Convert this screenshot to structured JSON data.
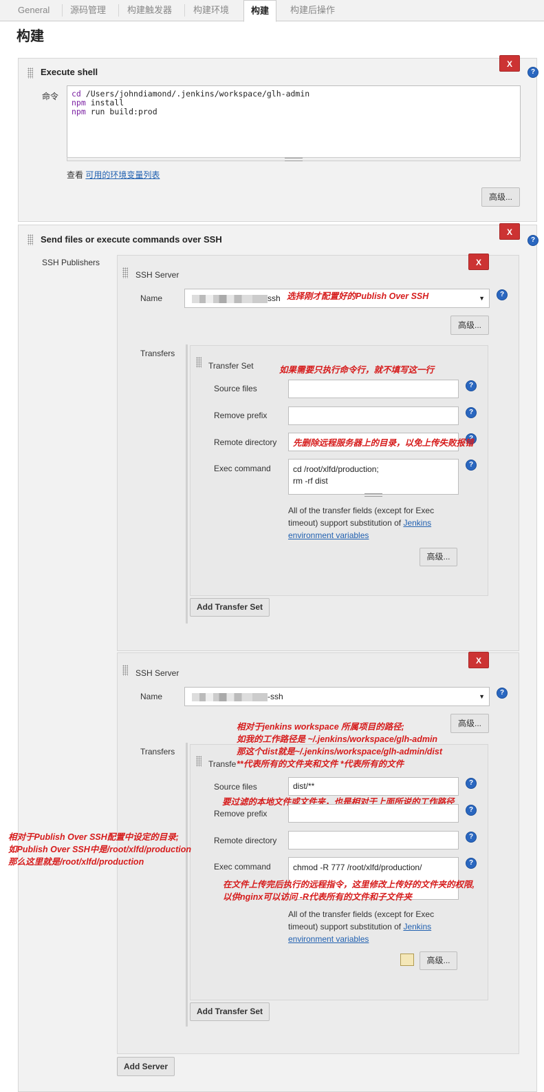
{
  "tabs": [
    "General",
    "源码管理",
    "构建触发器",
    "构建环境",
    "构建",
    "构建后操作"
  ],
  "page_title": "构建",
  "execute_shell": {
    "title": "Execute shell",
    "command_label": "命令",
    "command_lines": [
      {
        "kw": "cd",
        "rest": " /Users/johndiamond/.jenkins/workspace/glh-admin"
      },
      {
        "kw": "npm",
        "rest": " install"
      },
      {
        "kw": "npm",
        "rest": " run build:prod"
      }
    ],
    "env_prefix": "查看",
    "env_link": "可用的环境变量列表",
    "advanced": "高级..."
  },
  "ssh": {
    "title": "Send files or execute commands over SSH",
    "publishers_label": "SSH Publishers",
    "server_label": "SSH Server",
    "name_label": "Name",
    "transfers_label": "Transfers",
    "transfer_set_label": "Transfer Set",
    "source_label": "Source files",
    "remove_prefix_label": "Remove prefix",
    "remote_dir_label": "Remote directory",
    "exec_label": "Exec command",
    "help_line1": "All of the transfer fields (except for Exec",
    "help_line2": "timeout) support substitution of",
    "help_link1": "Jenkins",
    "help_link2": "environment variables",
    "advanced": "高级...",
    "add_transfer_set": "Add Transfer Set",
    "add_server": "Add Server",
    "delete": "X",
    "server1": {
      "name_suffix": "ssh",
      "source": "",
      "remove_prefix": "",
      "remote_dir": "",
      "exec_lines": [
        "cd /root/xlfd/production;",
        "rm -rf dist"
      ]
    },
    "server2": {
      "name_suffix": "-ssh",
      "transfer_set_fragment": "Transfe",
      "source": "dist/**",
      "remove_prefix": "",
      "remote_dir": "",
      "exec_lines": [
        "chmod -R 777 /root/xlfd/production/"
      ]
    }
  },
  "notes": {
    "n1": "选择刚才配置好的Publish Over SSH",
    "n2": "如果需要只执行命令行，就不填写这一行",
    "n3": "先删除远程服务器上的目录，以免上传失败报错",
    "n4": [
      "相对于jenkins workspace 所属项目的路径;",
      "如我的工作路径是 ~/.jenkins/workspace/glh-admin",
      "那这个dist就是~/.jenkins/workspace/glh-admin/dist",
      "**代表所有的文件夹和文件  *代表所有的文件"
    ],
    "n5": "要过滤的本地文件或文件夹，也是相对于上面所说的工作路径",
    "n6": [
      "相对于Publish Over SSH配置中设定的目录;",
      "如Publish Over SSH中是/root/xlfd/production",
      "那么这里就是/root/xlfd/production"
    ],
    "n7": [
      "在文件上传完后执行的远程指令，这里修改上传好的文件夹的权限,",
      "以供nginx可以访问 -R代表所有的文件和子文件夹"
    ]
  },
  "colors": {
    "accent_red": "#d61c1c",
    "delete_btn": "#cc3333",
    "link": "#2060b0"
  }
}
